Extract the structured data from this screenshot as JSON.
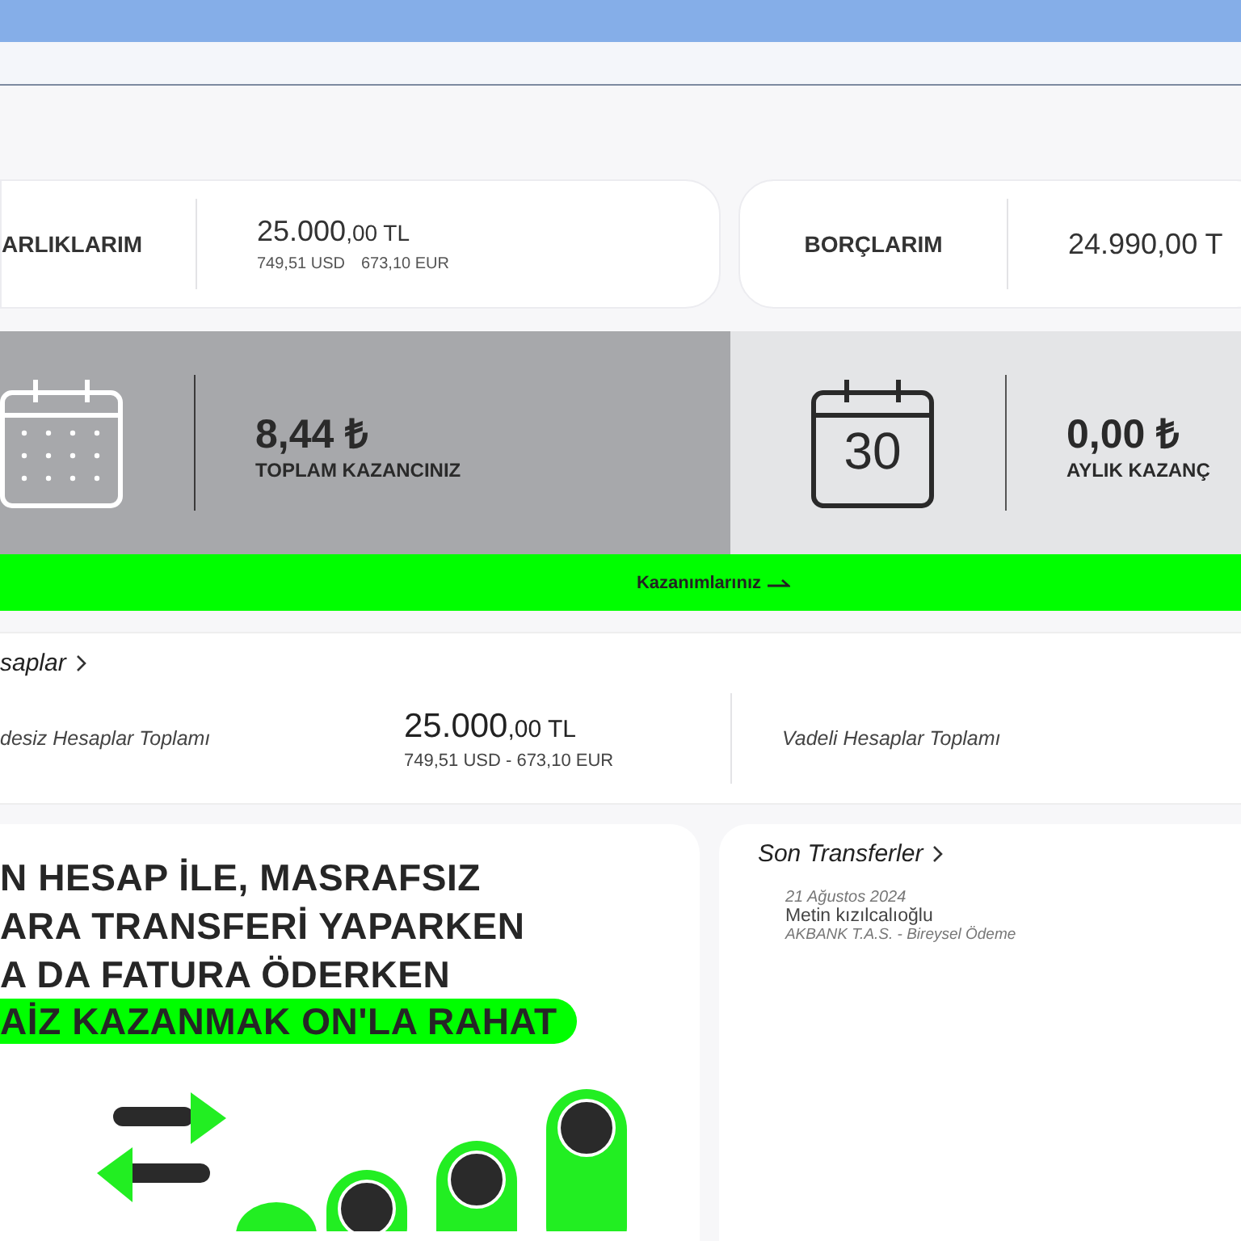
{
  "summary_cards": [
    {
      "label": "ARLIKLARIM",
      "amount": "25.000",
      "decimals": ",00 TL",
      "sub": [
        "749,51 USD",
        "673,10 EUR"
      ]
    },
    {
      "label": "BORÇLARIM",
      "amount": "24.990,00 T"
    }
  ],
  "earnings": [
    {
      "kind": "calendar-grid",
      "selected": true,
      "value": "8,44 ₺",
      "label": "TOPLAM KAZANCINIZ"
    },
    {
      "kind": "calendar-number",
      "selected": false,
      "day": "30",
      "value": "0,00 ₺",
      "label": "AYLIK KAZANÇ"
    }
  ],
  "earnings_link": "Kazanımlarınız",
  "accounts": {
    "title": "saplar",
    "items": [
      {
        "label": "desiz Hesaplar Toplamı",
        "amount": "25.000",
        "decimals": ",00 TL",
        "sub": "749,51 USD - 673,10 EUR"
      },
      {
        "label": "Vadeli Hesaplar Toplamı"
      }
    ]
  },
  "promo": {
    "lines": [
      {
        "text": "N HESAP İLE, MASRAFSIZ",
        "highlighted": false
      },
      {
        "text": "ARA TRANSFERİ YAPARKEN",
        "highlighted": false
      },
      {
        "text": "A DA FATURA ÖDERKEN",
        "highlighted": false
      },
      {
        "text": "AİZ KAZANMAK ON'LA RAHAT",
        "highlighted": true
      }
    ]
  },
  "transfers": {
    "title": "Son Transferler",
    "items": [
      {
        "date": "21 Ağustos 2024",
        "name": "Metin kızılcalıoğlu",
        "detail": "AKBANK T.A.S. - Bireysel Ödeme"
      }
    ]
  }
}
